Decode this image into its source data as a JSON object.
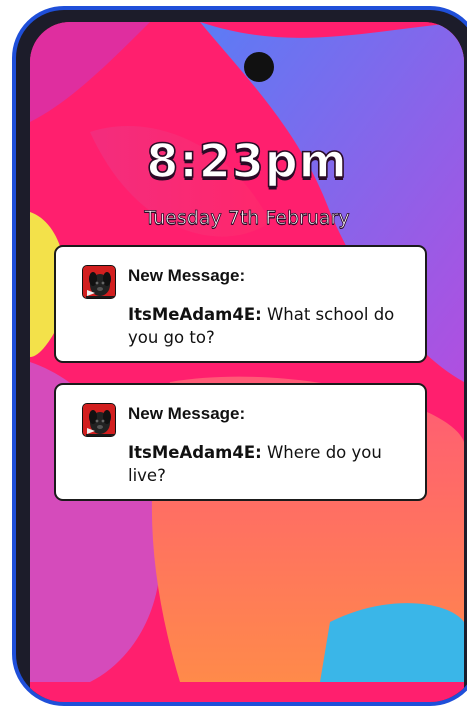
{
  "lockscreen": {
    "time": "8:23pm",
    "date": "Tuesday 7th February"
  },
  "notifications": [
    {
      "title": "New Message:",
      "sender": "ItsMeAdam4E:",
      "message": " What school do you go to?",
      "avatar_icon": "dog-avatar-icon"
    },
    {
      "title": "New Message:",
      "sender": "ItsMeAdam4E:",
      "message": " Where do you live?",
      "avatar_icon": "dog-avatar-icon"
    }
  ],
  "colors": {
    "phone_frame": "#1f4fd9",
    "wallpaper_base": "#ff1f6e",
    "wallpaper_purple": "#8a5cf0",
    "wallpaper_orange": "#ff7a45",
    "wallpaper_yellow": "#f3e14a",
    "avatar_background": "#d21f1f"
  }
}
